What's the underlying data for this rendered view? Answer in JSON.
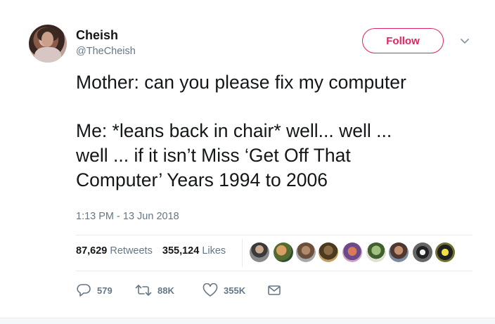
{
  "author": {
    "name": "Cheish",
    "handle": "@TheCheish"
  },
  "follow_label": "Follow",
  "tweet_lines_1": [
    "Mother: can you please fix my computer"
  ],
  "tweet_lines_2": [
    "Me: *leans back in chair* well... well ...",
    "well ... if it isn’t Miss ‘Get Off That",
    "Computer’ Years 1994 to 2006"
  ],
  "timestamp": "1:13 PM - 13 Jun 2018",
  "stats": {
    "retweets_count": "87,629",
    "retweets_label": "Retweets",
    "likes_count": "355,124",
    "likes_label": "Likes"
  },
  "actions": {
    "reply_count": "579",
    "retweet_count": "88K",
    "like_count": "355K"
  },
  "colors": {
    "accent": "#e0245e",
    "muted": "#657786",
    "text": "#14171a"
  }
}
